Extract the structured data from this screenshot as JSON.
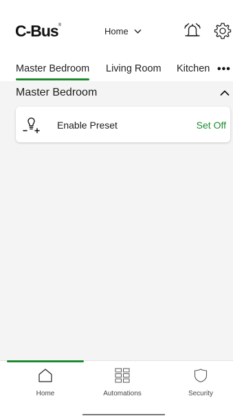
{
  "header": {
    "logo": "C-Bus",
    "logo_mark": "®",
    "home_label": "Home"
  },
  "tabs": [
    {
      "label": "Master Bedroom",
      "active": true
    },
    {
      "label": "Living Room",
      "active": false
    },
    {
      "label": "Kitchen",
      "active": false
    }
  ],
  "tabs_more": "•••",
  "section": {
    "title": "Master Bedroom"
  },
  "preset": {
    "icon": "lightbulb-icon",
    "label": "Enable Preset",
    "action": "Set Off"
  },
  "bottom_nav": [
    {
      "label": "Home",
      "icon": "home-icon",
      "active": true
    },
    {
      "label": "Automations",
      "icon": "grid-icon",
      "active": false
    },
    {
      "label": "Security",
      "icon": "shield-icon",
      "active": false
    }
  ],
  "colors": {
    "accent": "#1b8a2e",
    "background": "#f4f4f4"
  }
}
